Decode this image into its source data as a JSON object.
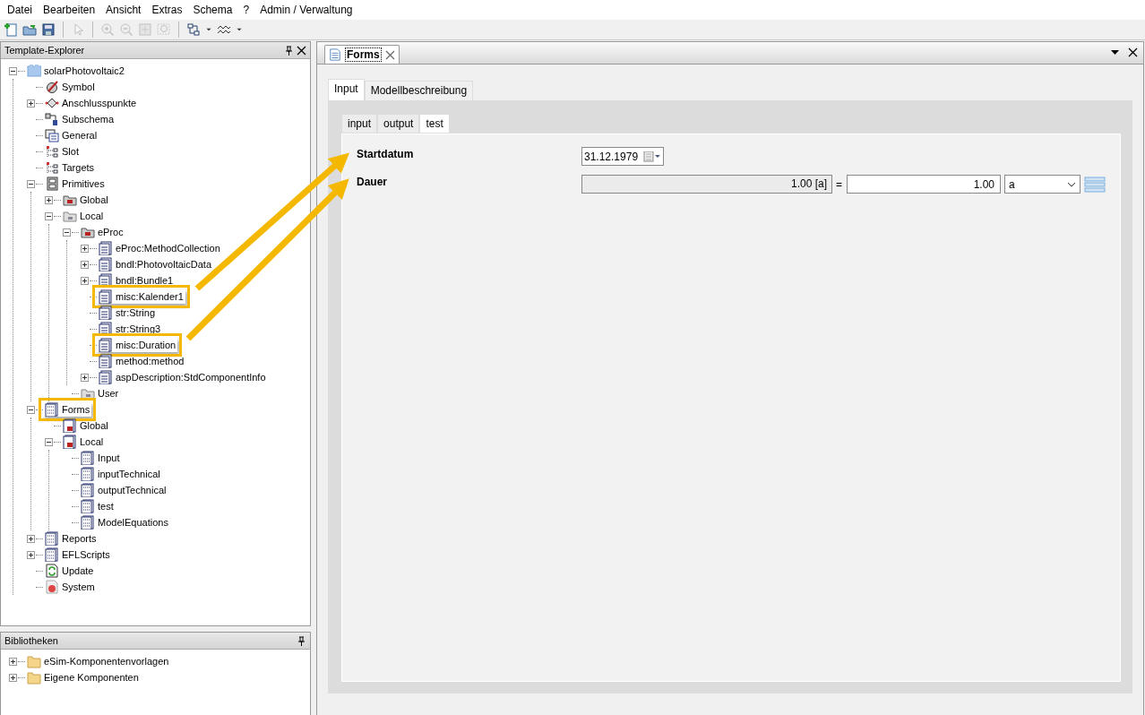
{
  "menu": [
    "Datei",
    "Bearbeiten",
    "Ansicht",
    "Extras",
    "Schema",
    "?",
    "Admin / Verwaltung"
  ],
  "toolbar": [
    {
      "kind": "new",
      "disabled": false
    },
    {
      "kind": "open",
      "disabled": false
    },
    {
      "kind": "save",
      "disabled": false
    },
    {
      "kind": "sep"
    },
    {
      "kind": "pointer",
      "disabled": true
    },
    {
      "kind": "sep"
    },
    {
      "kind": "zoom-in",
      "disabled": true
    },
    {
      "kind": "zoom-out",
      "disabled": true
    },
    {
      "kind": "fit",
      "disabled": true
    },
    {
      "kind": "zoom-rect",
      "disabled": true
    },
    {
      "kind": "sep"
    },
    {
      "kind": "layout",
      "disabled": false
    },
    {
      "kind": "dropdown",
      "disabled": false
    },
    {
      "kind": "wave",
      "disabled": false
    },
    {
      "kind": "dropdown",
      "disabled": false
    }
  ],
  "explorer": {
    "title": "Template-Explorer",
    "tree": [
      {
        "label": "solarPhotovoltaic2",
        "kind": "project",
        "expanded": true,
        "children": [
          {
            "label": "Symbol",
            "kind": "symbol"
          },
          {
            "label": "Anschlusspunkte",
            "kind": "connect",
            "expanded": false
          },
          {
            "label": "Subschema",
            "kind": "subschema"
          },
          {
            "label": "General",
            "kind": "general"
          },
          {
            "label": "Slot",
            "kind": "slot"
          },
          {
            "label": "Targets",
            "kind": "slot"
          },
          {
            "label": "Primitives",
            "kind": "cabinet",
            "expanded": true,
            "children": [
              {
                "label": "Global",
                "kind": "folder-red",
                "expanded": false
              },
              {
                "label": "Local",
                "kind": "folder-grey",
                "expanded": true,
                "children": [
                  {
                    "label": "eProc",
                    "kind": "folder-red",
                    "expanded": true,
                    "children": [
                      {
                        "label": "eProc:MethodCollection",
                        "kind": "doc",
                        "expanded": false
                      },
                      {
                        "label": "bndl:PhotovoltaicData",
                        "kind": "doc",
                        "expanded": false
                      },
                      {
                        "label": "bndl:Bundle1",
                        "kind": "doc",
                        "expanded": false
                      },
                      {
                        "label": "misc:Kalender1",
                        "kind": "doc",
                        "highlighted": true
                      },
                      {
                        "label": "str:String",
                        "kind": "doc"
                      },
                      {
                        "label": "str:String3",
                        "kind": "doc"
                      },
                      {
                        "label": "misc:Duration",
                        "kind": "doc",
                        "highlighted": true
                      },
                      {
                        "label": "method:method",
                        "kind": "doc"
                      },
                      {
                        "label": "aspDescription:StdComponentInfo",
                        "kind": "doc",
                        "expanded": false
                      }
                    ]
                  },
                  {
                    "label": "User",
                    "kind": "folder-grey"
                  }
                ]
              }
            ]
          },
          {
            "label": "Forms",
            "kind": "form",
            "expanded": true,
            "highlighted": true,
            "children": [
              {
                "label": "Global",
                "kind": "form-red"
              },
              {
                "label": "Local",
                "kind": "form-red",
                "expanded": true,
                "children": [
                  {
                    "label": "Input",
                    "kind": "form"
                  },
                  {
                    "label": "inputTechnical",
                    "kind": "form"
                  },
                  {
                    "label": "outputTechnical",
                    "kind": "form"
                  },
                  {
                    "label": "test",
                    "kind": "form"
                  },
                  {
                    "label": "ModelEquations",
                    "kind": "form"
                  }
                ]
              }
            ]
          },
          {
            "label": "Reports",
            "kind": "form",
            "expanded": false
          },
          {
            "label": "EFLScripts",
            "kind": "form",
            "expanded": false
          },
          {
            "label": "Update",
            "kind": "update"
          },
          {
            "label": "System",
            "kind": "system"
          }
        ]
      }
    ]
  },
  "libraries": {
    "title": "Bibliotheken",
    "items": [
      {
        "label": "eSim-Komponentenvorlagen",
        "expanded": false
      },
      {
        "label": "Eigene Komponenten",
        "expanded": false
      }
    ]
  },
  "document_tab": {
    "label": "Forms"
  },
  "outer_tabs": [
    {
      "label": "Input",
      "selected": true
    },
    {
      "label": "Modellbeschreibung",
      "selected": false
    }
  ],
  "inner_tabs": [
    {
      "label": "input",
      "selected": false
    },
    {
      "label": "output",
      "selected": false
    },
    {
      "label": "test",
      "selected": true
    }
  ],
  "form": {
    "startdatum": {
      "label": "Startdatum",
      "value": "31.12.1979"
    },
    "dauer": {
      "label": "Dauer",
      "display": "1.00 [a]",
      "equals": "=",
      "value": "1.00",
      "unit": "a"
    }
  }
}
